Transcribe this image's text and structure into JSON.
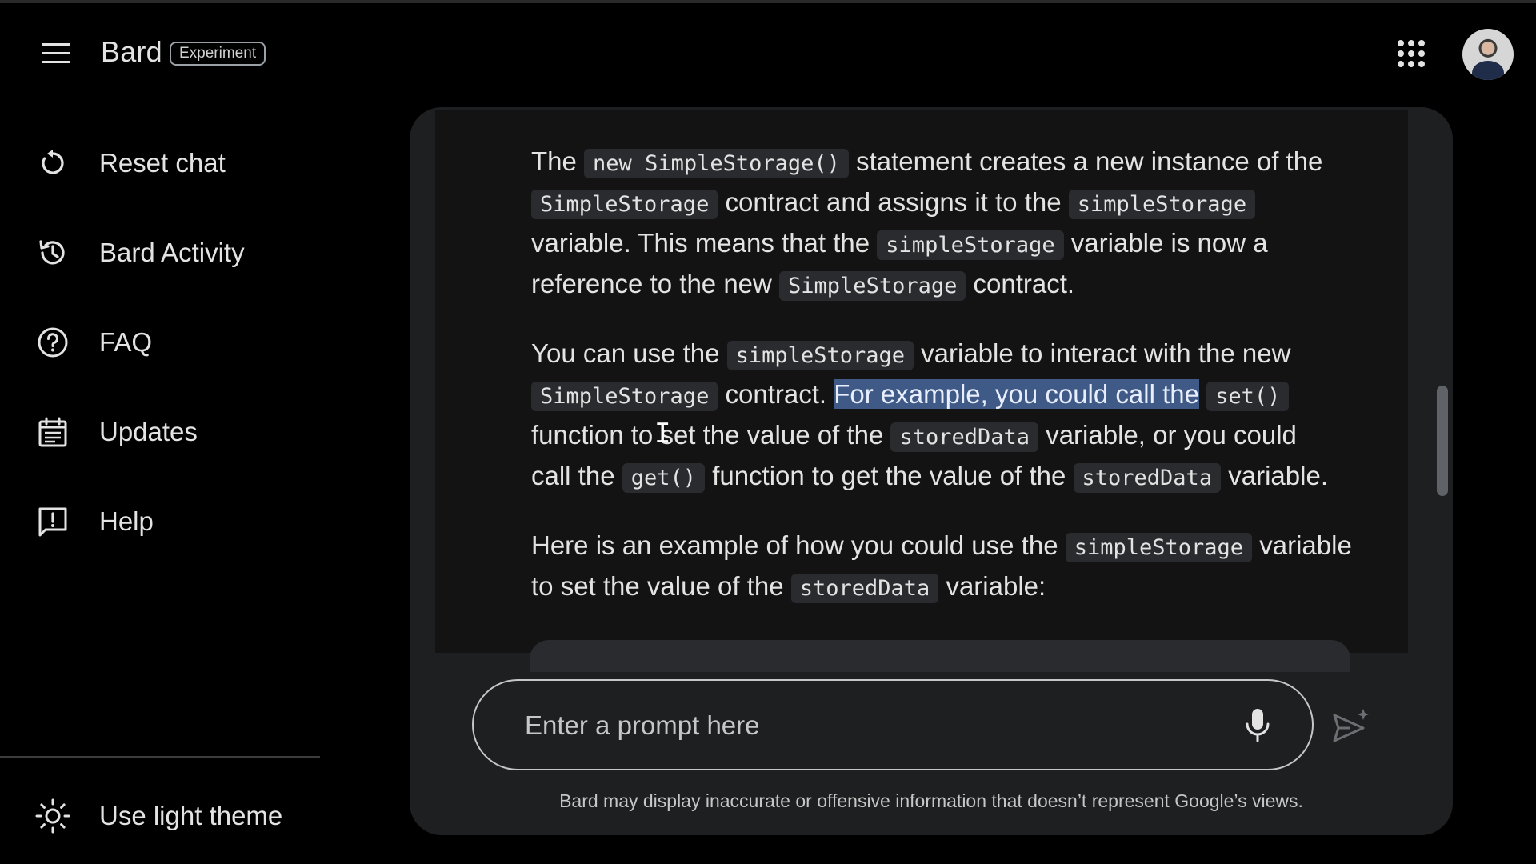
{
  "header": {
    "app_name": "Bard",
    "badge": "Experiment"
  },
  "sidebar": {
    "items": [
      {
        "label": "Reset chat",
        "icon": "reset-icon"
      },
      {
        "label": "Bard Activity",
        "icon": "history-icon"
      },
      {
        "label": "FAQ",
        "icon": "help-circle-icon"
      },
      {
        "label": "Updates",
        "icon": "calendar-icon"
      },
      {
        "label": "Help",
        "icon": "feedback-icon"
      }
    ],
    "theme_toggle": {
      "label": "Use light theme",
      "icon": "sun-icon"
    }
  },
  "chat": {
    "p1": {
      "t1": "The",
      "c1": "new SimpleStorage()",
      "t2": "statement creates a new instance of the",
      "c2": "SimpleStorage",
      "t3": "contract and assigns it to the",
      "c3": "simpleStorage",
      "t4": "variable. This means that the",
      "c4": "simpleStorage",
      "t5": "variable is now a",
      "t6": "reference to the new",
      "c5": "SimpleStorage",
      "t7": "contract."
    },
    "p2": {
      "t1": "You can use the",
      "c1": "simpleStorage",
      "t2": "variable to interact with the new",
      "c2": "SimpleStorage",
      "t3": "contract.",
      "hl": "For example, you could call the",
      "c3": "set()",
      "t4": "function to set the value of the",
      "c4": "storedData",
      "t5": "variable, or you could",
      "t6": "call the",
      "c5": "get()",
      "t7": "function to get the value of the",
      "c6": "storedData",
      "t8": "variable."
    },
    "p3": {
      "t1": "Here is an example of how you could use the",
      "c1": "simpleStorage",
      "t2": "variable",
      "t3": "to set the value of the",
      "c2": "storedData",
      "t4": "variable:"
    }
  },
  "input": {
    "placeholder": "Enter a prompt here"
  },
  "disclaimer": "Bard may display inaccurate or offensive information that doesn’t represent Google’s views.",
  "colors": {
    "background": "#000000",
    "panel": "#1e1f20",
    "chat_area": "#131314",
    "highlight": "#3f5a86",
    "code_bg": "#2a2b2e"
  }
}
